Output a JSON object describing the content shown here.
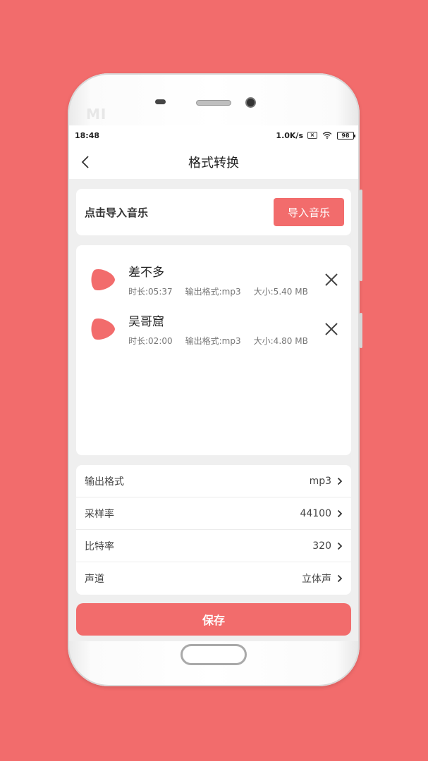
{
  "statusbar": {
    "time": "18:48",
    "speed": "1.0K/s",
    "battery": "98"
  },
  "nav": {
    "title": "格式转换"
  },
  "import": {
    "label": "点击导入音乐",
    "button": "导入音乐"
  },
  "songs": [
    {
      "name": "差不多",
      "duration": "时长:05:37",
      "format": "输出格式:mp3",
      "size": "大小:5.40 MB"
    },
    {
      "name": "吴哥窟",
      "duration": "时长:02:00",
      "format": "输出格式:mp3",
      "size": "大小:4.80 MB"
    }
  ],
  "settings": [
    {
      "label": "输出格式",
      "value": "mp3"
    },
    {
      "label": "采样率",
      "value": "44100"
    },
    {
      "label": "比特率",
      "value": "320"
    },
    {
      "label": "声道",
      "value": "立体声"
    }
  ],
  "save": {
    "label": "保存"
  },
  "colors": {
    "accent": "#f26c6c",
    "background": "#efefef"
  }
}
